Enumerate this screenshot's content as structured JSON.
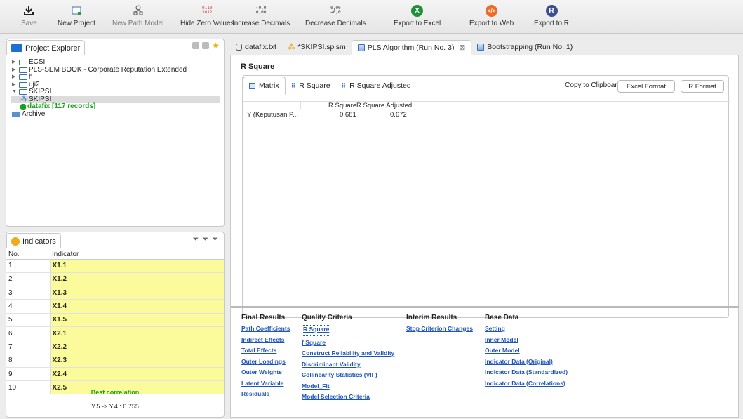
{
  "toolbar": {
    "save": "Save",
    "new_project": "New Project",
    "new_path_model": "New Path Model",
    "hide_zero_values": "Hide Zero Values",
    "hide_zero_icon": "0110\n3012",
    "increase_decimals": "Increase Decimals",
    "increase_icon": "←0,0\n0,00",
    "decrease_decimals": "Decrease Decimals",
    "decrease_icon": "0,00\n→0,0",
    "export_excel": "Export to Excel",
    "export_web": "Export to Web",
    "export_r": "Export to R"
  },
  "project_explorer": {
    "title": "Project Explorer",
    "items": [
      "ECSI",
      "PLS-SEM BOOK - Corporate Reputation Extended",
      "h",
      "uji2",
      "SKIPSI",
      "SKIPSI",
      "datafix [117 records]",
      "Archive"
    ]
  },
  "indicators": {
    "title": "Indicators",
    "col_no": "No.",
    "col_indicator": "Indicator",
    "rows": [
      {
        "no": "1",
        "name": "X1.1"
      },
      {
        "no": "2",
        "name": "X1.2"
      },
      {
        "no": "3",
        "name": "X1.3"
      },
      {
        "no": "4",
        "name": "X1.4"
      },
      {
        "no": "5",
        "name": "X1.5"
      },
      {
        "no": "6",
        "name": "X2.1"
      },
      {
        "no": "7",
        "name": "X2.2"
      },
      {
        "no": "8",
        "name": "X2.3"
      },
      {
        "no": "9",
        "name": "X2.4"
      },
      {
        "no": "10",
        "name": "X2.5"
      }
    ],
    "best_correlation_label": "Best correlation",
    "best_correlation_value": "Y.5 -> Y.4 : 0.755"
  },
  "editor_tabs": [
    "datafix.txt",
    "*SKIPSI.splsm",
    "PLS Algorithm (Run No. 3)",
    "Bootstrapping (Run No. 1)"
  ],
  "result": {
    "title": "R Square",
    "subtabs": [
      "Matrix",
      "R Square",
      "R Square Adjusted"
    ],
    "copy_label": "Copy to Clipboard:",
    "excel_format": "Excel Format",
    "r_format": "R Format",
    "headers": [
      "R Square",
      "R Square Adjusted"
    ],
    "row_label": "Y (Keputusan P...",
    "r_square": "0.681",
    "r_square_adj": "0.672"
  },
  "link_groups": {
    "final_results": {
      "title": "Final Results",
      "links": [
        "Path Coefficients",
        "Indirect Effects",
        "Total Effects",
        "Outer Loadings",
        "Outer Weights",
        "Latent Variable",
        "Residuals"
      ]
    },
    "quality_criteria": {
      "title": "Quality Criteria",
      "links": [
        "R Square",
        "f Square",
        "Construct Reliability and Validity",
        "Discriminant Validity",
        "Collinearity Statistics (VIF)",
        "Model_Fit",
        "Model Selection Criteria"
      ]
    },
    "interim_results": {
      "title": "Interim Results",
      "links": [
        "Stop Criterion Changes"
      ]
    },
    "base_data": {
      "title": "Base Data",
      "links": [
        "Setting",
        "Inner Model",
        "Outer Model",
        "Indicator Data (Original)",
        "Indicator Data (Standardized)",
        "Indicator Data (Correlations)"
      ]
    }
  },
  "colors": {
    "accent_link": "#1f55b8",
    "indicator_highlight": "#fbfb9b",
    "best_correlation": "#16a316",
    "excel": "#1f8f3a",
    "web": "#f06a25",
    "r": "#3b4f8f"
  }
}
